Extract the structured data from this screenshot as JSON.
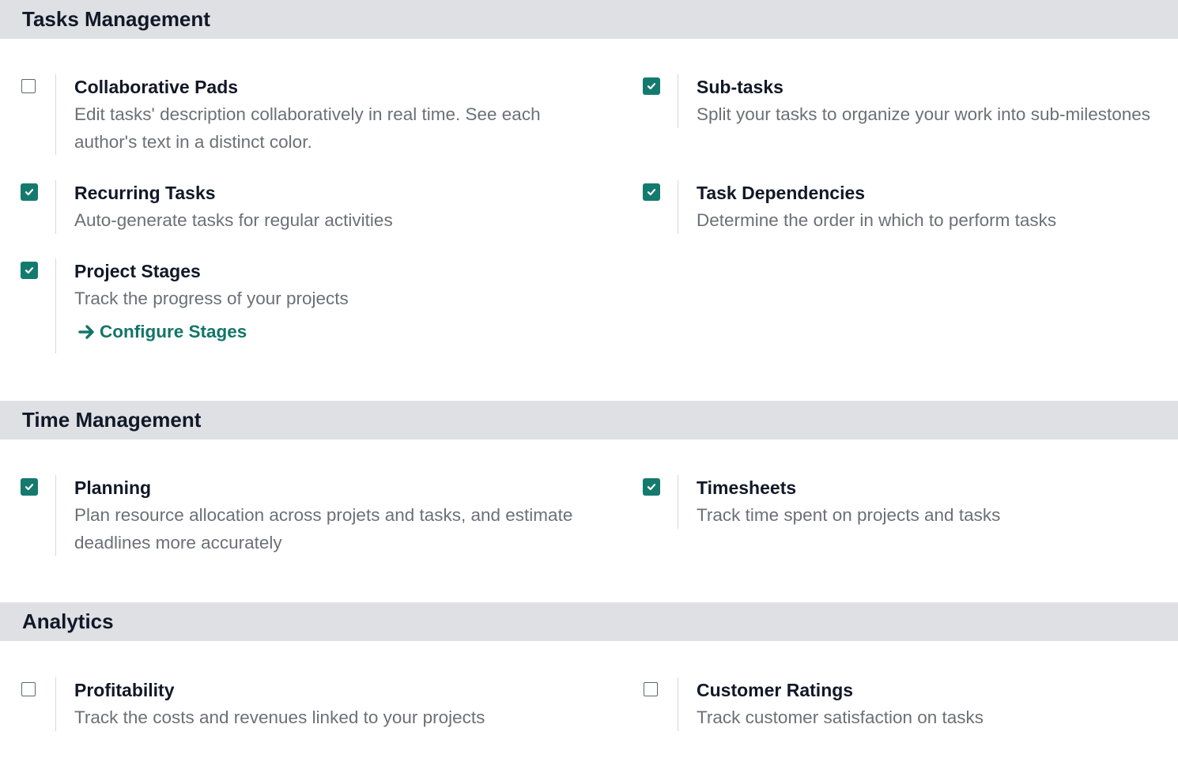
{
  "colors": {
    "accent": "#157a6e",
    "link": "#137568",
    "section_bg": "#dee0e4"
  },
  "sections": [
    {
      "title": "Tasks Management",
      "settings": [
        {
          "title": "Collaborative Pads",
          "description": "Edit tasks' description collaboratively in real time. See each author's text in a distinct color.",
          "checked": false
        },
        {
          "title": "Sub-tasks",
          "description": "Split your tasks to organize your work into sub-milestones",
          "checked": true
        },
        {
          "title": "Recurring Tasks",
          "description": "Auto-generate tasks for regular activities",
          "checked": true
        },
        {
          "title": "Task Dependencies",
          "description": "Determine the order in which to perform tasks",
          "checked": true
        },
        {
          "title": "Project Stages",
          "description": "Track the progress of your projects",
          "checked": true,
          "link": {
            "label": "Configure Stages",
            "icon": "arrow-right-icon"
          }
        }
      ]
    },
    {
      "title": "Time Management",
      "settings": [
        {
          "title": "Planning",
          "description": "Plan resource allocation across projets and tasks, and estimate deadlines more accurately",
          "checked": true
        },
        {
          "title": "Timesheets",
          "description": "Track time spent on projects and tasks",
          "checked": true
        }
      ]
    },
    {
      "title": "Analytics",
      "settings": [
        {
          "title": "Profitability",
          "description": "Track the costs and revenues linked to your projects",
          "checked": false
        },
        {
          "title": "Customer Ratings",
          "description": "Track customer satisfaction on tasks",
          "checked": false
        }
      ]
    }
  ]
}
